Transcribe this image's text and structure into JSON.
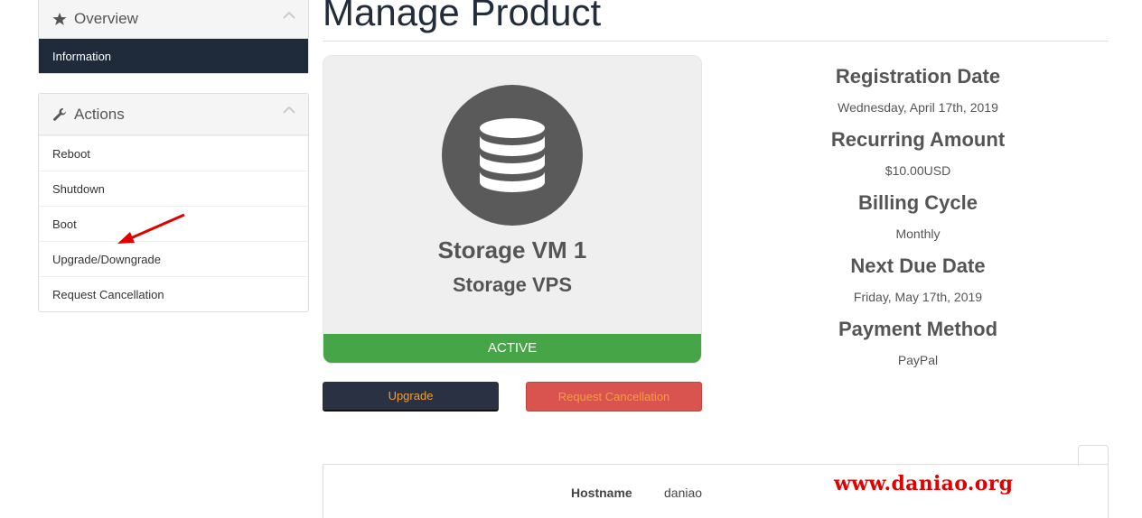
{
  "sidebar": {
    "overview": {
      "title": "Overview",
      "items": [
        {
          "label": "Information"
        }
      ]
    },
    "actions": {
      "title": "Actions",
      "items": [
        {
          "label": "Reboot"
        },
        {
          "label": "Shutdown"
        },
        {
          "label": "Boot"
        },
        {
          "label": "Upgrade/Downgrade"
        },
        {
          "label": "Request Cancellation"
        }
      ]
    }
  },
  "page": {
    "title": "Manage Product"
  },
  "product": {
    "name": "Storage VM 1",
    "group": "Storage VPS",
    "status": "ACTIVE",
    "icon": "database-icon"
  },
  "buttons": {
    "upgrade": "Upgrade",
    "cancel": "Request Cancellation"
  },
  "details": [
    {
      "label": "Registration Date",
      "value": "Wednesday, April 17th, 2019"
    },
    {
      "label": "Recurring Amount",
      "value": "$10.00USD"
    },
    {
      "label": "Billing Cycle",
      "value": "Monthly"
    },
    {
      "label": "Next Due Date",
      "value": "Friday, May 17th, 2019"
    },
    {
      "label": "Payment Method",
      "value": "PayPal"
    }
  ],
  "server": {
    "hostname_label": "Hostname",
    "hostname_value": "daniao"
  },
  "watermark": "www.daniao.org",
  "colors": {
    "nav_dark": "#1f2b3a",
    "active_green": "#46a546",
    "danger": "#d9534f",
    "button_dark": "#2a3143",
    "annotation_red": "#e00000"
  }
}
